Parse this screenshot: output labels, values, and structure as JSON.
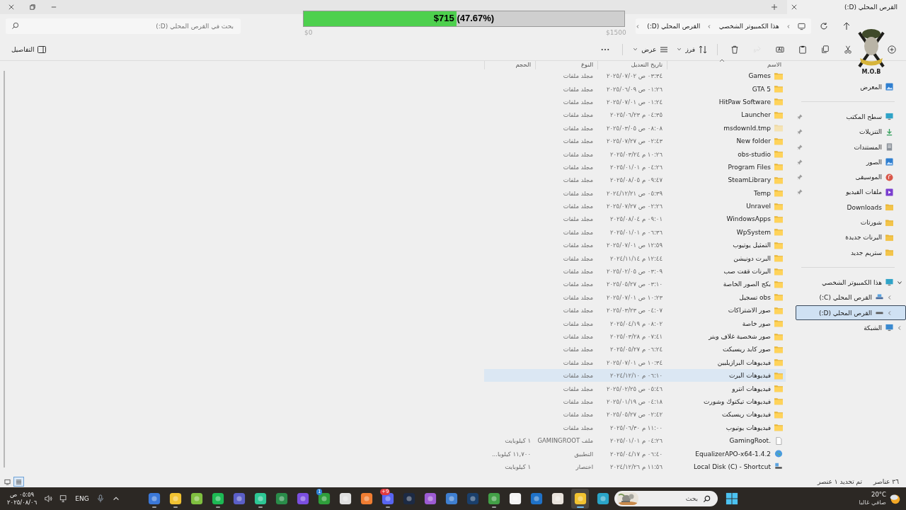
{
  "window": {
    "tab_title": "القرص المحلي (D:)"
  },
  "overlay": {
    "amount": "$715 (47.67%)",
    "level": 0.4767,
    "min": "$0",
    "max": "$1500"
  },
  "emblem": {
    "text": "M.O.B"
  },
  "address": {
    "breadcrumbs": [
      "هذا الكمبيوتر الشخصي",
      "القرص المحلي (D:)"
    ]
  },
  "search": {
    "placeholder": "بحث في القرص المحلي (D:)"
  },
  "toolbar": {
    "actions": [
      {
        "kind": "new",
        "disabled": false
      },
      {
        "kind": "cut",
        "disabled": false
      },
      {
        "kind": "copy",
        "disabled": false
      },
      {
        "kind": "paste",
        "disabled": false
      },
      {
        "kind": "rename",
        "disabled": false
      },
      {
        "kind": "share",
        "disabled": true
      },
      {
        "kind": "delete",
        "disabled": false
      }
    ],
    "sort": "فرز",
    "view": "عرض",
    "details": "التفاصيل"
  },
  "sidebar": {
    "gallery": "المعرض",
    "quick_access": [
      {
        "label": "سطح المكتب",
        "kind": "desktop",
        "pinned": true
      },
      {
        "label": "التنزيلات",
        "kind": "downloads",
        "pinned": true
      },
      {
        "label": "المستندات",
        "kind": "documents",
        "pinned": true
      },
      {
        "label": "الصور",
        "kind": "pictures",
        "pinned": true
      },
      {
        "label": "الموسيقى",
        "kind": "music",
        "pinned": true
      },
      {
        "label": "ملفات الفيديو",
        "kind": "videos",
        "pinned": true
      },
      {
        "label": "Downloads",
        "kind": "folder",
        "pinned": false
      },
      {
        "label": "شورتات",
        "kind": "folder",
        "pinned": false
      },
      {
        "label": "البرنات جديدة",
        "kind": "folder",
        "pinned": false
      },
      {
        "label": "ستريم جديد",
        "kind": "folder",
        "pinned": false
      }
    ],
    "tree": [
      {
        "label": "هذا الكمبيوتر الشخصي",
        "kind": "pc",
        "expanded": true,
        "selected": false,
        "children": [
          {
            "label": "القرص المحلي (C:)",
            "kind": "drive_c",
            "expanded": false,
            "selected": false
          },
          {
            "label": "القرص المحلي (D:)",
            "kind": "drive",
            "expanded": false,
            "selected": true
          }
        ]
      },
      {
        "label": "الشبكة",
        "kind": "network",
        "expanded": false,
        "selected": false
      }
    ]
  },
  "table": {
    "columns": [
      "الاسم",
      "تاريخ التعديل",
      "النوع",
      "الحجم"
    ],
    "rows": [
      {
        "kind": "folder",
        "name": "Games",
        "modified": "٠٣:٣٤ ص ٢٠٢٥/٠٧/٠٢",
        "type": "مجلد ملفات",
        "hidden": false,
        "selected": false
      },
      {
        "kind": "folder",
        "name": "GTA 5",
        "modified": "٠١:٢٦ ص ٢٠٢٥/٠٦/٠٩",
        "type": "مجلد ملفات",
        "hidden": false,
        "selected": false
      },
      {
        "kind": "folder",
        "name": "HitPaw Software",
        "modified": "٠١:٢٤ ص ٢٠٢٥/٠٧/٠١",
        "type": "مجلد ملفات",
        "hidden": false,
        "selected": false
      },
      {
        "kind": "folder",
        "name": "Launcher",
        "modified": "٠٤:٣٥ م ٢٠٢٥/٠٦/٢٣",
        "type": "مجلد ملفات",
        "hidden": false,
        "selected": false
      },
      {
        "kind": "folder",
        "name": "msdownld.tmp",
        "modified": "٠٨:٠٨ ص ٢٠٢٥/٠٣/٠٥",
        "type": "مجلد ملفات",
        "hidden": true,
        "selected": false
      },
      {
        "kind": "folder",
        "name": "New folder",
        "modified": "٠٢:٤٣ ص ٢٠٢٥/٠٧/٢٧",
        "type": "مجلد ملفات",
        "hidden": false,
        "selected": false
      },
      {
        "kind": "folder",
        "name": "obs-studio",
        "modified": "١٠:٢٦ م ٢٠٢٥/٠٣/٢٤",
        "type": "مجلد ملفات",
        "hidden": false,
        "selected": false
      },
      {
        "kind": "folder",
        "name": "Program Files",
        "modified": "٠٤:٢٦ م ٢٠٢٥/٠١/٠١",
        "type": "مجلد ملفات",
        "hidden": false,
        "selected": false
      },
      {
        "kind": "folder",
        "name": "SteamLibrary",
        "modified": "٠٩:٤٧ م ٢٠٢٥/٠٨/٠٥",
        "type": "مجلد ملفات",
        "hidden": false,
        "selected": false
      },
      {
        "kind": "folder",
        "name": "Temp",
        "modified": "٠٥:٣٩ ص ٢٠٢٤/١٢/٢١",
        "type": "مجلد ملفات",
        "hidden": false,
        "selected": false
      },
      {
        "kind": "folder",
        "name": "Unravel",
        "modified": "٠٢:٢٦ ص ٢٠٢٥/٠٧/٢٧",
        "type": "مجلد ملفات",
        "hidden": false,
        "selected": false
      },
      {
        "kind": "folder",
        "name": "WindowsApps",
        "modified": "٠٩:٠١ م ٢٠٢٥/٠٨/٠٤",
        "type": "مجلد ملفات",
        "hidden": false,
        "selected": false
      },
      {
        "kind": "folder",
        "name": "WpSystem",
        "modified": "٠٦:٣٦ م ٢٠٢٥/٠١/٠١",
        "type": "مجلد ملفات",
        "hidden": false,
        "selected": false
      },
      {
        "kind": "folder",
        "name": "التمثيل يوتيوب",
        "modified": "١٢:٥٩ ص ٢٠٢٥/٠٧/٠١",
        "type": "مجلد ملفات",
        "hidden": false,
        "selected": false
      },
      {
        "kind": "folder",
        "name": "البرت دونيشن",
        "modified": "١٢:٤٤ م ٢٠٢٤/١١/١٤",
        "type": "مجلد ملفات",
        "hidden": false,
        "selected": false
      },
      {
        "kind": "folder",
        "name": "البرنات قفت صب",
        "modified": "٠٣:٠٩ ص ٢٠٢٥/٠٢/٠٥",
        "type": "مجلد ملفات",
        "hidden": false,
        "selected": false
      },
      {
        "kind": "folder",
        "name": "بكج الصور الخاصة",
        "modified": "٠٣:١٠ ص ٢٠٢٥/٠٥/٢٧",
        "type": "مجلد ملفات",
        "hidden": false,
        "selected": false
      },
      {
        "kind": "folder",
        "name": "obs تسجيل",
        "modified": "١٠:٢٣ ص ٢٠٢٥/٠٧/٠١",
        "type": "مجلد ملفات",
        "hidden": false,
        "selected": false
      },
      {
        "kind": "folder",
        "name": "صور الاشتراكات",
        "modified": "٠٤:٠٧ ص ٢٠٢٥/٠٣/٢٣",
        "type": "مجلد ملفات",
        "hidden": false,
        "selected": false
      },
      {
        "kind": "folder",
        "name": "صور خاصة",
        "modified": "٠٨:٠٢ م ٢٠٢٥/٠٤/١٩",
        "type": "مجلد ملفات",
        "hidden": false,
        "selected": false
      },
      {
        "kind": "folder",
        "name": "صور شخصية غلاف وبنر",
        "modified": "٠٧:٤١ م ٢٠٢٥/٠٣/٢٨",
        "type": "مجلد ملفات",
        "hidden": false,
        "selected": false
      },
      {
        "kind": "folder",
        "name": "صور كابد ريسبكت",
        "modified": "٠٦:٢٤ م ٢٠٢٥/٠٥/٢٧",
        "type": "مجلد ملفات",
        "hidden": false,
        "selected": false
      },
      {
        "kind": "folder",
        "name": "فيديوهات البرازيليين",
        "modified": "١٠:٣٤ ص ٢٠٢٥/٠٧/٠١",
        "type": "مجلد ملفات",
        "hidden": false,
        "selected": false
      },
      {
        "kind": "folder",
        "name": "فيديوهات البرت",
        "modified": "٠٦:١٠ م ٢٠٢٤/١٢/١٠",
        "type": "مجلد ملفات",
        "hidden": false,
        "selected": true
      },
      {
        "kind": "folder",
        "name": "فيديوهات انترو",
        "modified": "٠٥:٤٦ ص ٢٠٢٥/٠٢/٢٥",
        "type": "مجلد ملفات",
        "hidden": false,
        "selected": false
      },
      {
        "kind": "folder",
        "name": "فيديوهات تيكتوك وشورت",
        "modified": "٠٤:١٨ ص ٢٠٢٥/٠١/١٩",
        "type": "مجلد ملفات",
        "hidden": false,
        "selected": false
      },
      {
        "kind": "folder",
        "name": "فيديوهات ريسبكت",
        "modified": "٠٢:٤٢ ص ٢٠٢٥/٠٥/٢٧",
        "type": "مجلد ملفات",
        "hidden": false,
        "selected": false
      },
      {
        "kind": "folder",
        "name": "فيديوهات يوتيوب",
        "modified": "١١:٠٠ م ٢٠٢٥/٠٦/٣٠",
        "type": "مجلد ملفات",
        "hidden": false,
        "selected": false
      },
      {
        "kind": "file",
        "name": ".GamingRoot",
        "modified": "٠٤:٢٦ م ٢٠٢٥/٠١/٠١",
        "type": "ملف GAMINGROOT",
        "size": "١ كيلوبايت",
        "hidden": false,
        "selected": false
      },
      {
        "kind": "app",
        "name": "EqualizerAPO-x64-1.4.2",
        "modified": "٠٦:٤٠ م ٢٠٢٥/٠٤/١٧",
        "type": "التطبيق",
        "size": "١١,٧٠٠ كيلوبا...",
        "hidden": false,
        "selected": false
      },
      {
        "kind": "shortcut",
        "name": "Local Disk (C) - Shortcut",
        "modified": "١١:٥٦ م ٢٠٢٤/١٢/٢٦",
        "type": "اختصار",
        "size": "١ كيلوبايت",
        "hidden": false,
        "selected": false
      }
    ]
  },
  "status_bar": {
    "count": "٣٦ عناصر",
    "selection": "تم تحديد ١ عنصر",
    "view_modes": [
      {
        "kind": "tiles",
        "selected": false
      },
      {
        "kind": "details",
        "selected": true
      }
    ]
  },
  "taskbar": {
    "weather": {
      "temperature": "20°C",
      "condition": "صافي غالبا"
    },
    "search": {
      "placeholder": "بحث"
    },
    "apps": [
      {
        "color": "#2aa5c8",
        "running": false,
        "selected": false
      },
      {
        "color": "#f2c230",
        "running": true,
        "selected": true
      },
      {
        "color": "#e9e3dc",
        "running": false,
        "selected": false
      },
      {
        "color": "#1f72c8",
        "running": false,
        "selected": false
      },
      {
        "color": "#f4f4f4",
        "running": false,
        "selected": false
      },
      {
        "color": "#43a047",
        "running": true,
        "selected": false
      },
      {
        "color": "#1a3f6b",
        "running": false,
        "selected": false
      },
      {
        "color": "#3f7fd0",
        "running": false,
        "selected": false
      },
      {
        "color": "#9d5bd2",
        "running": false,
        "selected": false
      },
      {
        "color": "#1c2a44",
        "running": false,
        "selected": false
      },
      {
        "color": "#5865f2",
        "running": true,
        "selected": false,
        "badge": {
          "text": "9+",
          "color": "#e0393e"
        }
      },
      {
        "color": "#f07d32",
        "running": false,
        "selected": false
      },
      {
        "color": "#e0e0e0",
        "running": false,
        "selected": false
      },
      {
        "color": "#2f9e3b",
        "running": false,
        "selected": false,
        "badge": {
          "text": "1",
          "color": "#2d7fd3"
        }
      },
      {
        "color": "#7b4fe0",
        "running": false,
        "selected": false
      },
      {
        "color": "#2a8c4a",
        "running": false,
        "selected": false
      },
      {
        "color": "#2ec795",
        "running": true,
        "selected": false
      },
      {
        "color": "#5b5fc7",
        "running": false,
        "selected": false
      },
      {
        "color": "#1db954",
        "running": true,
        "selected": false
      },
      {
        "color": "#7fbf3f",
        "running": false,
        "selected": false
      },
      {
        "color": "#f1c232",
        "running": true,
        "selected": false
      },
      {
        "color": "#3b78d8",
        "running": true,
        "selected": false
      }
    ],
    "language": "ENG",
    "time": "٠٥:٥٩ ص",
    "date": "٢٠٢٥/٠٨/٠٦"
  }
}
